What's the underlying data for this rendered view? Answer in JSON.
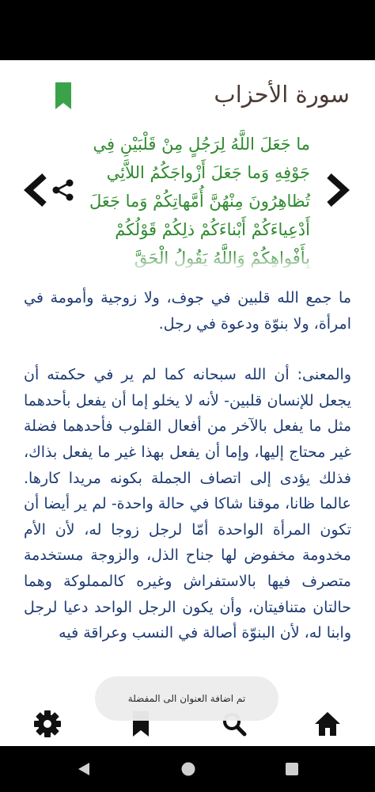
{
  "header": {
    "surah_title": "سورة الأحزاب"
  },
  "icons": {
    "bookmark_top": "bookmark-icon",
    "share": "share-icon",
    "prev": "chevron-left-icon",
    "next": "chevron-right-icon",
    "settings": "gear-icon",
    "bookmarks": "bookmark-icon",
    "search": "search-icon",
    "home": "home-icon"
  },
  "verse": {
    "text": "ما جَعَلَ اللَّهُ لِرَجُلٍ مِنْ قَلْبَيْنِ فِي جَوْفِهِ وَما جَعَلَ أَزْواجَكُمُ اللاَّئِي تُظاهِرُونَ مِنْهُنَّ أُمَّهاتِكُمْ وَما جَعَلَ أَدْعِياءَكُمْ أَبْناءَكُمْ ذلِكُمْ قَوْلُكُمْ بِأَفْواهِكُمْ وَاللَّهُ يَقُولُ الْحَقَّ"
  },
  "tafsir": {
    "paragraph1": "ما جمع الله قلبين في جوف، ولا زوجية وأمومة في امرأة، ولا بنوّة ودعوة في رجل.",
    "paragraph2": "والمعنى: أن الله سبحانه كما لم ير في حكمته أن يجعل للإنسان قلبين- لأنه لا يخلو إما أن يفعل بأحدهما مثل ما يفعل بالآخر من أفعال القلوب فأحدهما فضلة غير محتاج إليها، وإما أن يفعل بهذا غير ما يفعل بذاك، فذلك يؤدى إلى اتصاف الجملة بكونه مريدا كارها. عالما ظانا، موقنا شاكا في حالة واحدة- لم ير أيضا أن تكون المرأة الواحدة أمّا لرجل زوجا له، لأن الأم مخدومة مخفوض لها جناح الذل، والزوجة مستخدمة متصرف فيها بالاستفراش وغيره كالمملوكة وهما حالتان متنافيتان، وأن يكون الرجل الواحد دعيا لرجل وابنا له، لأن البنوّة أصالة في النسب وعراقة فيه"
  },
  "toast": {
    "message": "تم اضافة العنوان الى المفضلة"
  },
  "colors": {
    "verse": "#2f8a2f",
    "tafsir": "#1e3b72",
    "title": "#4a3a34",
    "bookmark": "#3aa34a"
  }
}
